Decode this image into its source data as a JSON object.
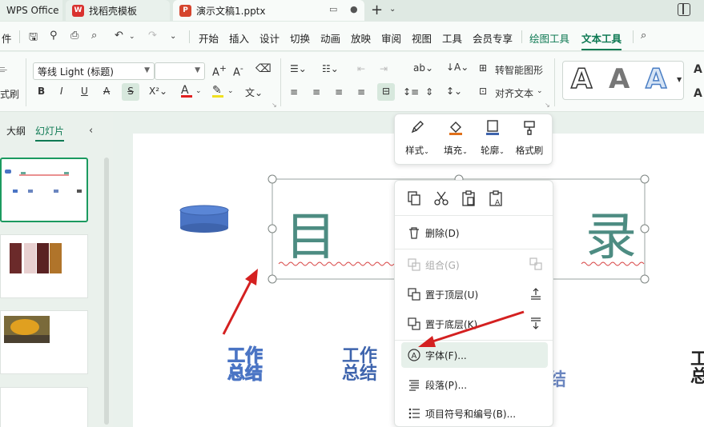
{
  "tabs": {
    "wps": "WPS Office",
    "template": "找稻壳模板",
    "document": "演示文稿1.pptx"
  },
  "menu": {
    "file": "件",
    "items": [
      "开始",
      "插入",
      "设计",
      "切换",
      "动画",
      "放映",
      "审阅",
      "视图",
      "工具",
      "会员专享"
    ],
    "drawing_tools": "绘图工具",
    "text_tools": "文本工具"
  },
  "toolbar": {
    "left_label": "式刷",
    "font_name": "等线 Light (标题)",
    "font_size": "",
    "convert_smartart": "转智能图形",
    "align_text": "对齐文本"
  },
  "left_panel": {
    "tab_outline": "大纲",
    "tab_slides": "幻灯片"
  },
  "slide": {
    "title_left": "目",
    "title_right": "录",
    "item_text_top": "工作",
    "item_text_bottom": "总结",
    "item_partial": "结",
    "item_partial_right": "工总"
  },
  "float_toolbar": {
    "style": "样式",
    "fill": "填充",
    "outline": "轮廓",
    "format_painter": "格式刷"
  },
  "context_menu": {
    "delete": "删除(D)",
    "group": "组合(G)",
    "bring_to_front": "置于顶层(U)",
    "send_to_back": "置于底层(K)",
    "font": "字体(F)...",
    "paragraph": "段落(P)...",
    "bullets": "项目符号和编号(B)..."
  },
  "colors": {
    "accent": "#0f7a54",
    "title_text": "#4d8c82",
    "shape_blue": "#4a74c4",
    "arrow_red": "#d42020"
  }
}
